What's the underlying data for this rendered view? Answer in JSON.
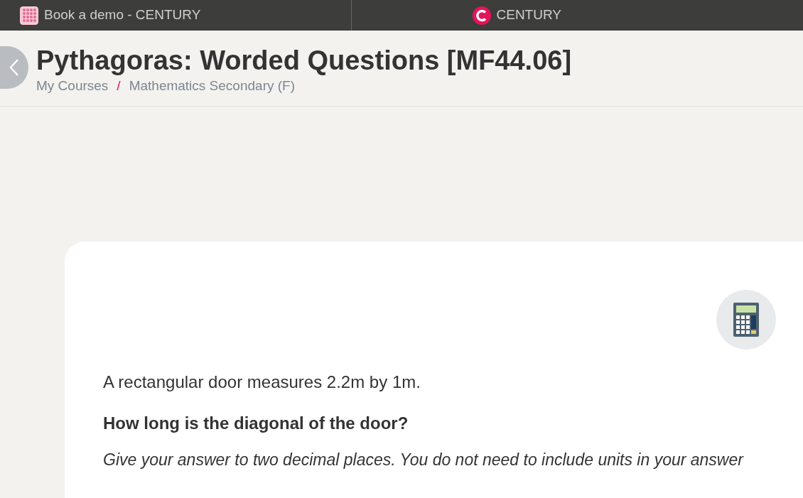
{
  "tabs": [
    {
      "label": "Book a demo - CENTURY",
      "kind": "favicon"
    },
    {
      "label": "CENTURY",
      "kind": "logo"
    }
  ],
  "header": {
    "title": "Pythagoras: Worded Questions [MF44.06]",
    "breadcrumb": [
      "My Courses",
      "Mathematics Secondary (F)"
    ],
    "separator": "/"
  },
  "question": {
    "statement": "A rectangular door measures 2.2m by 1m.",
    "prompt": "How long is the diagonal of the door?",
    "instruction": "Give your answer to two decimal places. You do not need to include units in your answer"
  }
}
